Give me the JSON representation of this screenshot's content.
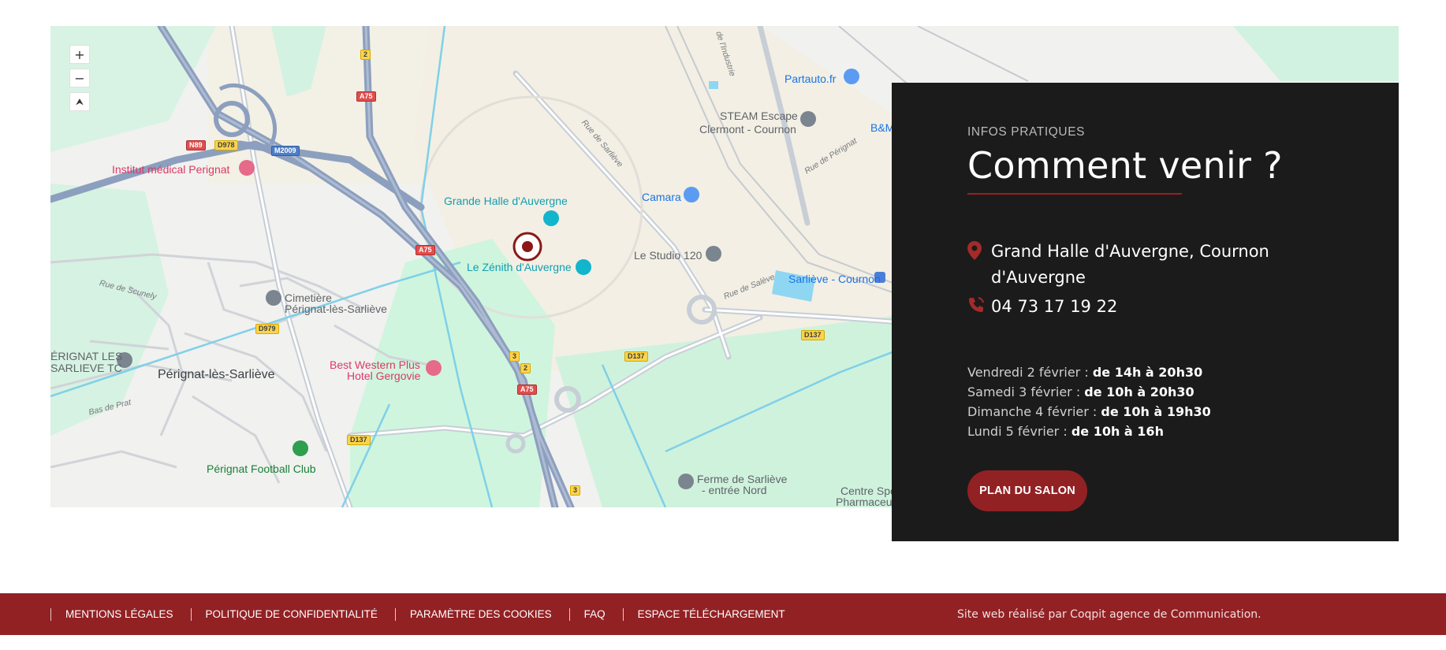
{
  "map": {
    "zoom_in": "+",
    "zoom_out": "−",
    "locate": "⮝",
    "places": {
      "grande_halle": "Grande Halle d'Auvergne",
      "zenith": "Le Zénith d'Auvergne",
      "institut": "Institut médical Perignat",
      "partauto": "Partauto.fr",
      "steam_1": "STEAM Escape",
      "steam_2": "Clermont - Cournon",
      "bm": "B&M",
      "camara": "Camara",
      "studio": "Le Studio 120",
      "sarlieve_cournon": "Sarliève - Cournon",
      "cimetiere_1": "Cimetière",
      "cimetiere_2": "Pérignat-lès-Sarliève",
      "perignat": "Pérignat-lès-Sarliève",
      "perignat_tc_1": "ÉRIGNAT LES",
      "perignat_tc_2": "SARLIEVE TC",
      "best_western_1": "Best Western Plus",
      "best_western_2": "Hotel Gergovie",
      "football": "Pérignat Football Club",
      "ferme_1": "Ferme de Sarliève",
      "ferme_2": "- entrée Nord",
      "centre_1": "Centre Spo",
      "centre_2": "Pharmaceu"
    },
    "streets": {
      "rue_sarlieve": "Rue de Sarliève",
      "rue_industrie": "de l'Industrie",
      "rue_perignat": "Rue de Pérignat",
      "rue_scunely": "Rue de Scunely",
      "bas_prat": "Bas de Prat",
      "rue_salve": "Rue de Salève"
    },
    "shields": {
      "n89": "N89",
      "d978": "D978",
      "m2009": "M2009",
      "a75_a": "A75",
      "a75_b": "A75",
      "a75_c": "A75",
      "two_a": "2",
      "two_b": "2",
      "three_a": "3",
      "three_b": "3",
      "d979": "D979",
      "d137_a": "D137",
      "d137_b": "D137",
      "d137_c": "D137"
    }
  },
  "info": {
    "eyebrow": "INFOS PRATIQUES",
    "title": "Comment venir ?",
    "address": "Grand Halle d'Auvergne, Cournon d'Auvergne",
    "phone": "04 73 17 19 22",
    "schedule": [
      {
        "day": "Vendredi 2 février : ",
        "hours": "de 14h à 20h30"
      },
      {
        "day": "Samedi 3 février : ",
        "hours": "de 10h à 20h30"
      },
      {
        "day": "Dimanche 4 février : ",
        "hours": "de 10h à 19h30"
      },
      {
        "day": "Lundi 5 février : ",
        "hours": "de 10h à 16h"
      }
    ],
    "button": "PLAN DU SALON",
    "accent": "#922124"
  },
  "footer": {
    "links": [
      "MENTIONS LÉGALES",
      "POLITIQUE DE CONFIDENTIALITÉ",
      "PARAMÈTRE DES COOKIES",
      "FAQ",
      "ESPACE TÉLÉCHARGEMENT"
    ],
    "credit": "Site web réalisé par Coqpit agence de Communication."
  }
}
